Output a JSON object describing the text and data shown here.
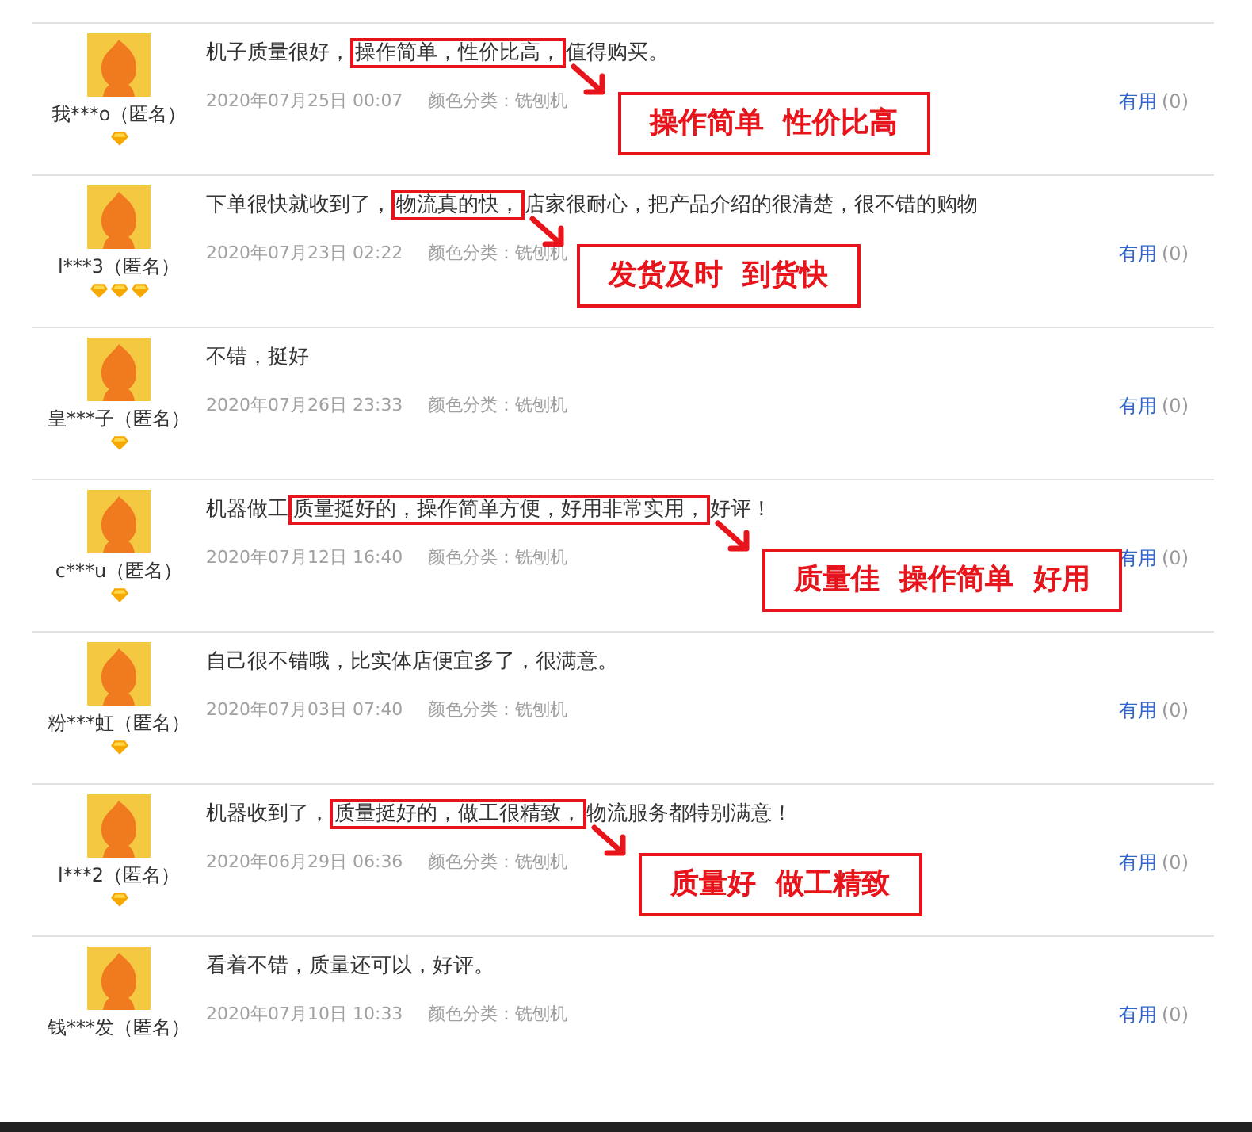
{
  "reviews": [
    {
      "user": "我***o（匿名）",
      "badges": [
        {
          "kind": "diamond"
        }
      ],
      "text_before": "机子质量很好，",
      "highlight": "操作简单，性价比高，",
      "text_after": "值得购买。",
      "date": "2020年07月25日 00:07",
      "variant": "颜色分类：铣刨机",
      "useful": "有用",
      "useful_count": "(0)",
      "callout": "操作简单  性价比高"
    },
    {
      "user": "l***3（匿名）",
      "badges": [
        {
          "kind": "diamond"
        },
        {
          "kind": "diamond"
        },
        {
          "kind": "diamond"
        }
      ],
      "text_before": "下单很快就收到了，",
      "highlight": "物流真的快，",
      "text_after": "店家很耐心，把产品介绍的很清楚，很不错的购物",
      "date": "2020年07月23日 02:22",
      "variant": "颜色分类：铣刨机",
      "useful": "有用",
      "useful_count": "(0)",
      "callout": "发货及时  到货快"
    },
    {
      "user": "皇***子（匿名）",
      "badges": [
        {
          "kind": "diamond"
        }
      ],
      "text_before": "不错，挺好",
      "date": "2020年07月26日 23:33",
      "variant": "颜色分类：铣刨机",
      "useful": "有用",
      "useful_count": "(0)"
    },
    {
      "user": "c***u（匿名）",
      "badges": [
        {
          "kind": "diamond"
        }
      ],
      "text_before": "机器做工",
      "highlight": "质量挺好的，操作简单方便，好用非常实用，",
      "text_after": "好评！",
      "date": "2020年07月12日 16:40",
      "variant": "颜色分类：铣刨机",
      "useful": "有用",
      "useful_count": "(0)",
      "callout": "质量佳  操作简单  好用"
    },
    {
      "user": "粉***虹（匿名）",
      "badges": [
        {
          "kind": "diamond"
        }
      ],
      "text_before": "自己很不错哦，比实体店便宜多了，很满意。",
      "date": "2020年07月03日 07:40",
      "variant": "颜色分类：铣刨机",
      "useful": "有用",
      "useful_count": "(0)"
    },
    {
      "user": "l***2（匿名）",
      "badges": [
        {
          "kind": "diamond"
        }
      ],
      "text_before": "机器收到了，",
      "highlight": "质量挺好的，做工很精致，",
      "text_after": "物流服务都特别满意！",
      "date": "2020年06月29日 06:36",
      "variant": "颜色分类：铣刨机",
      "useful": "有用",
      "useful_count": "(0)",
      "callout": "质量好  做工精致"
    },
    {
      "user": "钱***发（匿名）",
      "text_before": "看着不错，质量还可以，好评。",
      "date": "2020年07月10日 10:33",
      "variant": "颜色分类：铣刨机",
      "useful": "有用",
      "useful_count": "(0)"
    }
  ]
}
